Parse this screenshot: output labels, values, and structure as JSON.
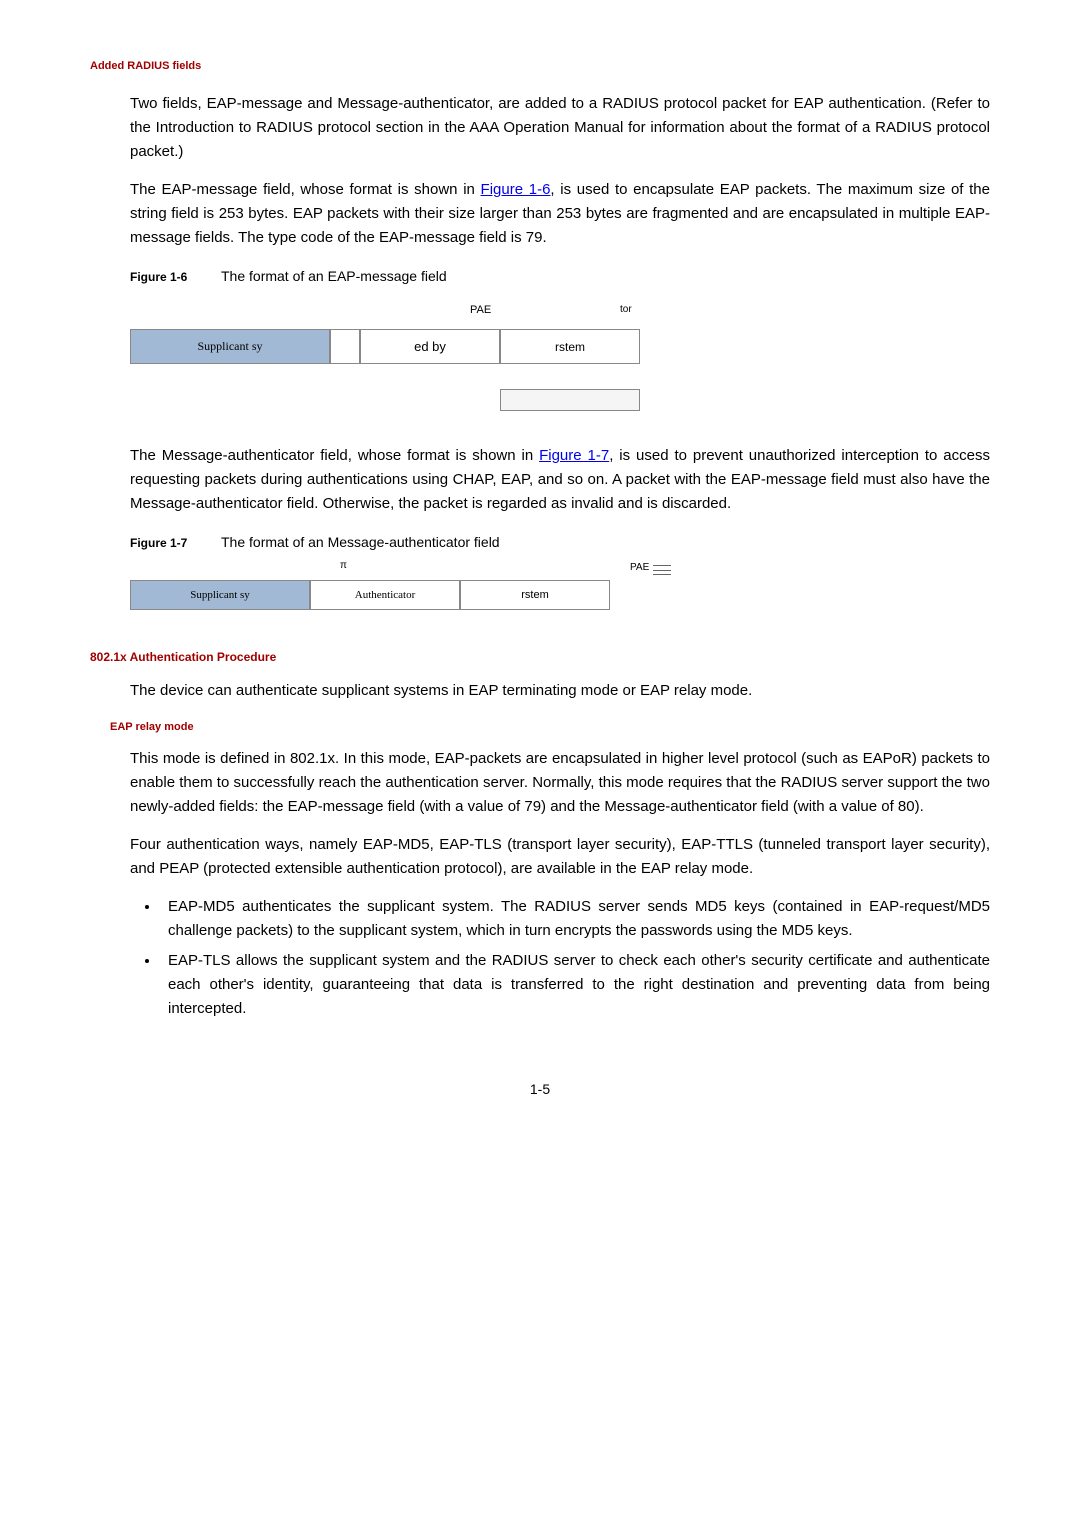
{
  "section1_header": "Added RADIUS fields",
  "para1": "Two fields, EAP-message and Message-authenticator, are added to a RADIUS protocol packet for EAP authentication. (Refer to the Introduction to RADIUS protocol section in the AAA Operation Manual for information about the format of a RADIUS protocol packet.)",
  "para2a": "The EAP-message field, whose format is shown in ",
  "para2_link": "Figure 1-6",
  "para2b": ", is used to encapsulate EAP packets. The maximum size of the string field is 253 bytes. EAP packets with their size larger than 253 bytes are fragmented and are encapsulated in multiple EAP-message fields. The type code of the EAP-message field is 79.",
  "fig1_num": "Figure 1-6",
  "fig1_caption": "The format of an EAP-message field",
  "fig1_box1": "Supplicant sy",
  "fig1_box3": "ed by",
  "fig1_box4": "rstem",
  "fig1_lbl1": "PAE",
  "fig1_lbl2": "tor",
  "para3a": "The Message-authenticator field, whose format is shown in ",
  "para3_link": "Figure 1-7",
  "para3b": ", is used to prevent unauthorized interception to access requesting packets during authentications using CHAP, EAP, and so on. A packet with the EAP-message field must also have the Message-authenticator field. Otherwise, the packet is regarded as invalid and is discarded.",
  "fig2_num": "Figure 1-7",
  "fig2_caption": "The format of an Message-authenticator field",
  "fig2_lbl_top": "π",
  "fig2_lbl_right": "PAE",
  "fig2_box1": "Supplicant sy",
  "fig2_box2": "Authenticator",
  "fig2_box3": "rstem",
  "section2_header": "802.1x Authentication Procedure",
  "para4": "The device can authenticate supplicant systems in EAP terminating mode or EAP relay mode.",
  "subsub_header": "EAP relay mode",
  "para5": "This mode is defined in 802.1x. In this mode, EAP-packets are encapsulated in higher level protocol (such as EAPoR) packets to enable them to successfully reach the authentication server. Normally, this mode requires that the RADIUS server support the two newly-added fields: the EAP-message field (with a value of 79) and the Message-authenticator field (with a value of 80).",
  "para6": "Four authentication ways, namely EAP-MD5, EAP-TLS (transport layer security), EAP-TTLS (tunneled transport layer security), and PEAP (protected extensible authentication protocol), are available in the EAP relay mode.",
  "bullet1": "EAP-MD5 authenticates the supplicant system. The RADIUS server sends MD5 keys (contained in EAP-request/MD5 challenge packets) to the supplicant system, which in turn encrypts the passwords using the MD5 keys.",
  "bullet2": "EAP-TLS allows the supplicant system and the RADIUS server to check each other's security certificate and authenticate each other's identity, guaranteeing that data is transferred to the right destination and preventing data from being intercepted.",
  "page_number": "1-5"
}
